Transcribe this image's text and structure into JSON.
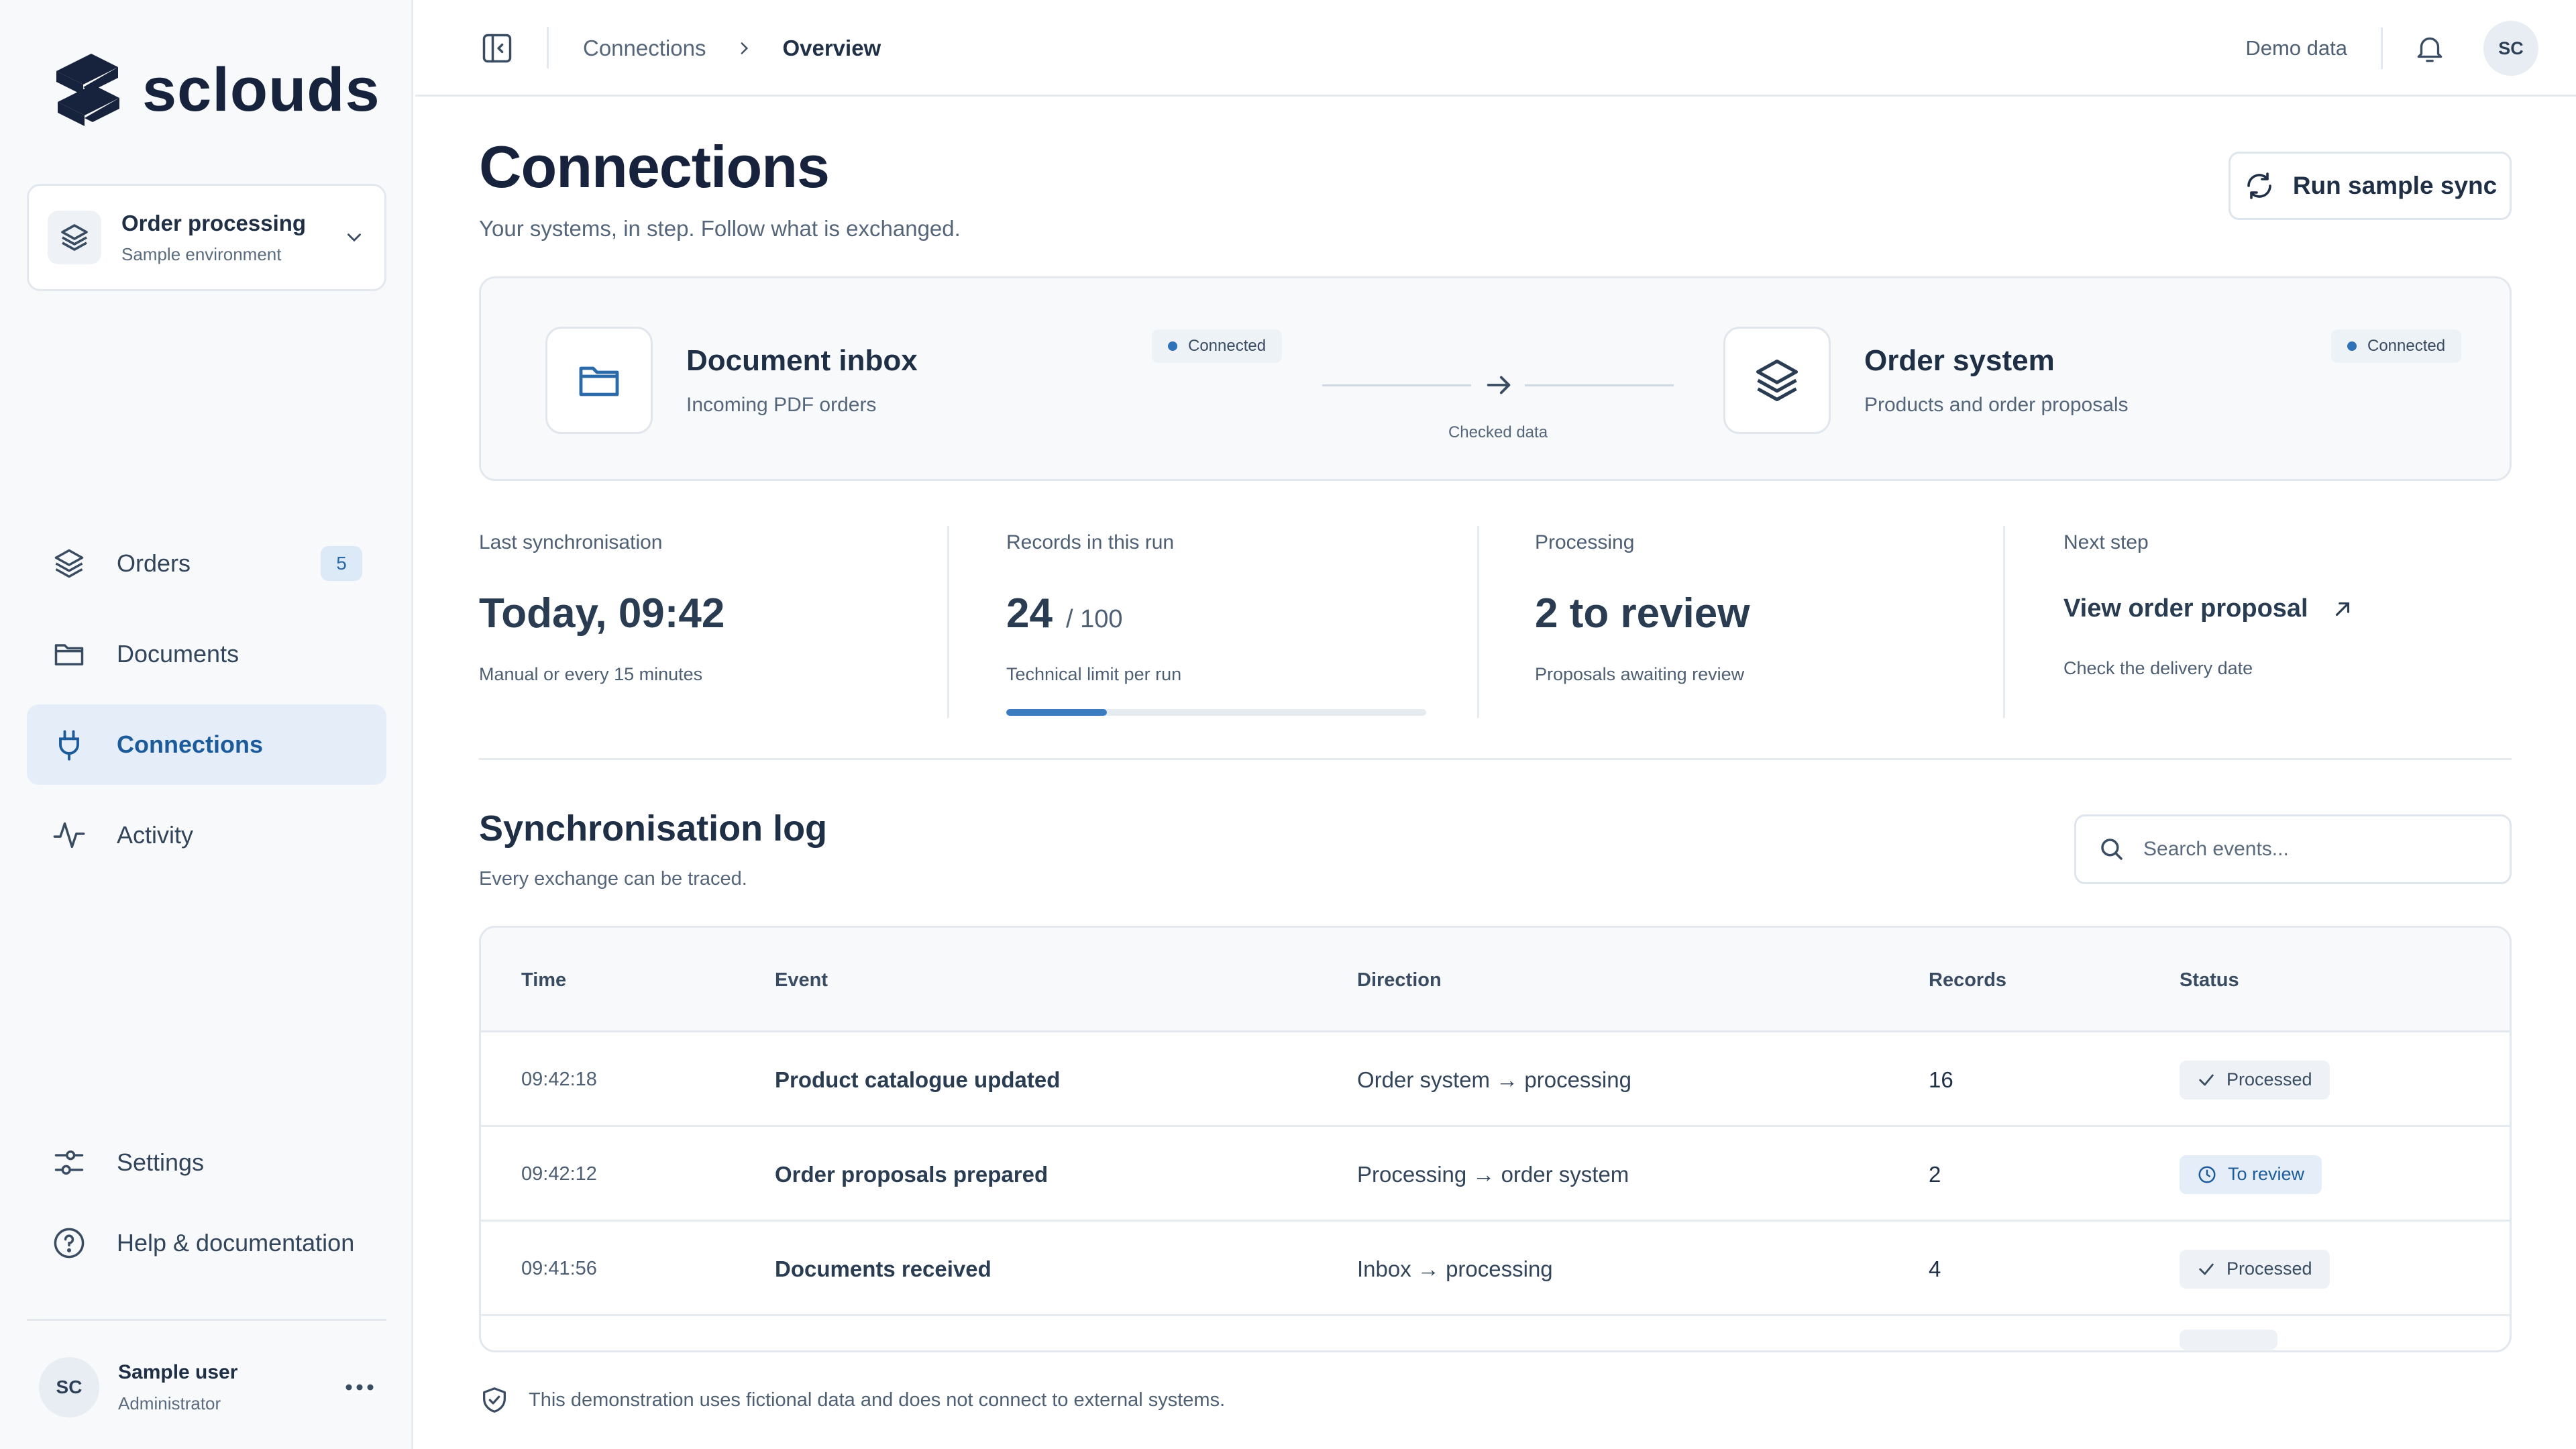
{
  "brand": {
    "name": "sclouds"
  },
  "environment": {
    "title": "Order processing",
    "subtitle": "Sample environment"
  },
  "sidebar": {
    "items": [
      {
        "label": "Orders",
        "badge": "5",
        "icon": "layers-icon"
      },
      {
        "label": "Documents",
        "icon": "folder-icon"
      },
      {
        "label": "Connections",
        "icon": "plug-icon",
        "active": true
      },
      {
        "label": "Activity",
        "icon": "activity-icon"
      }
    ],
    "bottom": [
      {
        "label": "Settings",
        "icon": "sliders-icon"
      },
      {
        "label": "Help & documentation",
        "icon": "help-icon"
      }
    ]
  },
  "user": {
    "initials": "SC",
    "name": "Sample user",
    "role": "Administrator"
  },
  "topbar": {
    "breadcrumb": [
      "Connections",
      "Overview"
    ],
    "demo_label": "Demo data",
    "initials": "SC"
  },
  "page": {
    "title": "Connections",
    "subtitle": "Your systems, in step. Follow what is exchanged.",
    "run_button": "Run sample sync"
  },
  "connection": {
    "source": {
      "title": "Document inbox",
      "subtitle": "Incoming PDF orders",
      "status": "Connected"
    },
    "flow_label": "Checked data",
    "target": {
      "title": "Order system",
      "subtitle": "Products and order proposals",
      "status": "Connected"
    }
  },
  "stats": {
    "last_sync": {
      "label": "Last synchronisation",
      "value": "Today, 09:42",
      "hint": "Manual or every 15 minutes"
    },
    "records": {
      "label": "Records in this run",
      "value": "24",
      "limit": "/ 100",
      "hint": "Technical limit per run",
      "progress": 0.24
    },
    "processing": {
      "label": "Processing",
      "value": "2 to review",
      "hint": "Proposals awaiting review"
    },
    "next_step": {
      "label": "Next step",
      "link": "View order proposal",
      "hint": "Check the delivery date"
    }
  },
  "log": {
    "title": "Synchronisation log",
    "subtitle": "Every exchange can be traced.",
    "search_placeholder": "Search events...",
    "columns": [
      "Time",
      "Event",
      "Direction",
      "Records",
      "Status"
    ],
    "rows": [
      {
        "time": "09:42:18",
        "event": "Product catalogue updated",
        "direction": "Order system → processing",
        "records": "16",
        "status": "Processed"
      },
      {
        "time": "09:42:12",
        "event": "Order proposals prepared",
        "direction": "Processing → order system",
        "records": "2",
        "status": "To review"
      },
      {
        "time": "09:41:56",
        "event": "Documents received",
        "direction": "Inbox → processing",
        "records": "4",
        "status": "Processed"
      }
    ]
  },
  "footer": {
    "note": "This demonstration uses fictional data and does not connect to external systems."
  },
  "colors": {
    "accent": "#1c5b9b",
    "active_bg": "#e5eef8",
    "progress": "#3b7cc0",
    "text": "#1f2f45"
  }
}
